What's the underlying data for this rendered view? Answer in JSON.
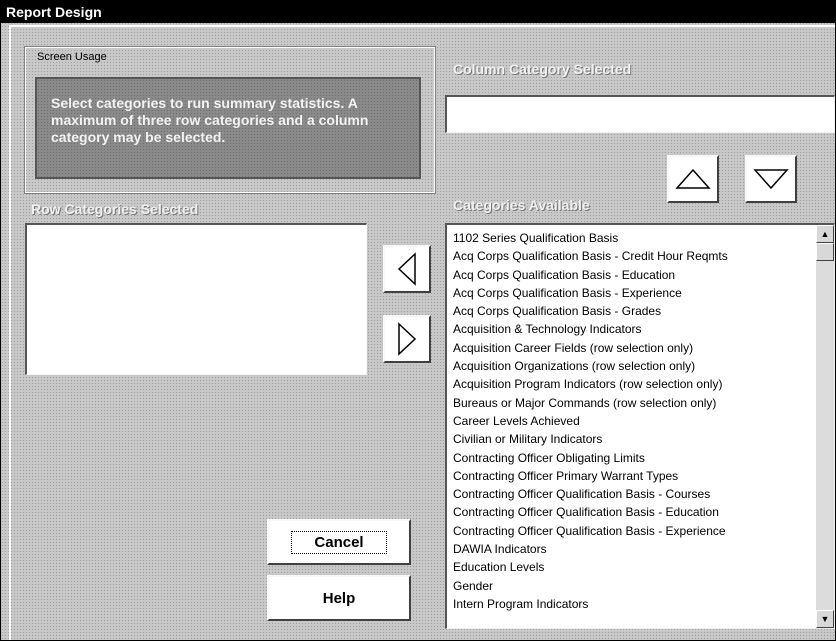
{
  "window": {
    "title": "Report Design"
  },
  "screen_usage": {
    "label": "Screen Usage",
    "text": "Select categories to run summary statistics. A maximum of three row categories and a column category may be selected."
  },
  "column_category": {
    "heading": "Column Category Selected",
    "value": ""
  },
  "row_categories": {
    "heading": "Row Categories Selected",
    "items": []
  },
  "available": {
    "heading": "Categories Available",
    "items": [
      "1102 Series Qualification Basis",
      "Acq Corps Qualification Basis - Credit Hour Reqmts",
      "Acq Corps Qualification Basis - Education",
      "Acq Corps Qualification Basis - Experience",
      "Acq Corps Qualification Basis - Grades",
      "Acquisition & Technology Indicators",
      "Acquisition Career Fields (row selection only)",
      "Acquisition Organizations (row selection only)",
      "Acquisition Program Indicators (row selection only)",
      "Bureaus or Major Commands (row selection only)",
      "Career Levels Achieved",
      "Civilian or Military Indicators",
      "Contracting Officer Obligating Limits",
      "Contracting Officer Primary Warrant Types",
      "Contracting Officer Qualification Basis - Courses",
      "Contracting Officer Qualification Basis - Education",
      "Contracting Officer Qualification Basis - Experience",
      "DAWIA Indicators",
      "Education Levels",
      "Gender",
      "Intern Program Indicators"
    ]
  },
  "buttons": {
    "cancel": "Cancel",
    "help": "Help"
  },
  "icons": {
    "move_up": "triangle-up-icon",
    "move_down": "triangle-down-icon",
    "add_to_rows": "triangle-left-icon",
    "remove_from_rows": "triangle-right-icon"
  }
}
